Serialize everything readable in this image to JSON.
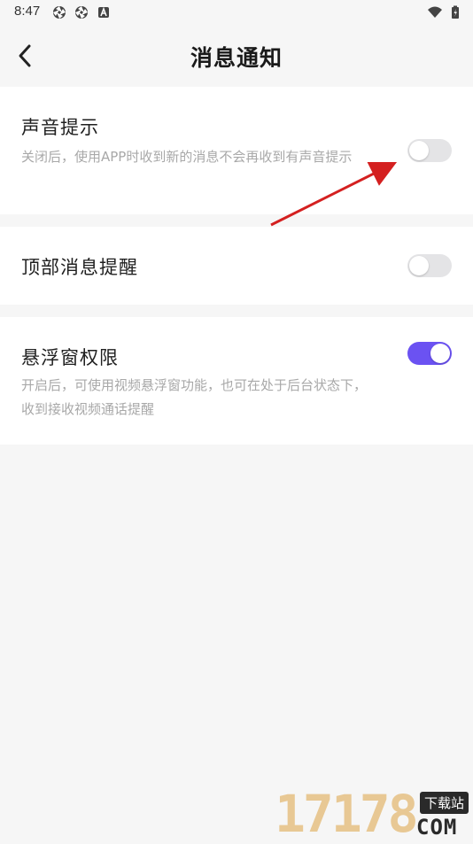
{
  "status_bar": {
    "time": "8:47",
    "left_icons": [
      "aperture-icon",
      "aperture-icon",
      "a-badge-icon"
    ],
    "right_icons": [
      "wifi-icon",
      "battery-icon"
    ]
  },
  "header": {
    "back_icon": "chevron-left-icon",
    "title": "消息通知"
  },
  "settings": [
    {
      "title": "声音提示",
      "desc": "关闭后，使用APP时收到新的消息不会再收到有声音提示",
      "enabled": false
    },
    {
      "title": "顶部消息提醒",
      "desc": "",
      "enabled": false
    },
    {
      "title": "悬浮窗权限",
      "desc": "开启后，可使用视频悬浮窗功能，也可在处于后台状态下，收到接收视频通话提醒",
      "enabled": true
    }
  ],
  "annotation": {
    "arrow_color": "#d42020"
  },
  "colors": {
    "toggle_on": "#6b52f2",
    "toggle_off": "#e4e4e6",
    "background": "#f6f6f6"
  },
  "watermark": {
    "digits": "17178",
    "tag": "下载站",
    "suffix": "COM"
  }
}
